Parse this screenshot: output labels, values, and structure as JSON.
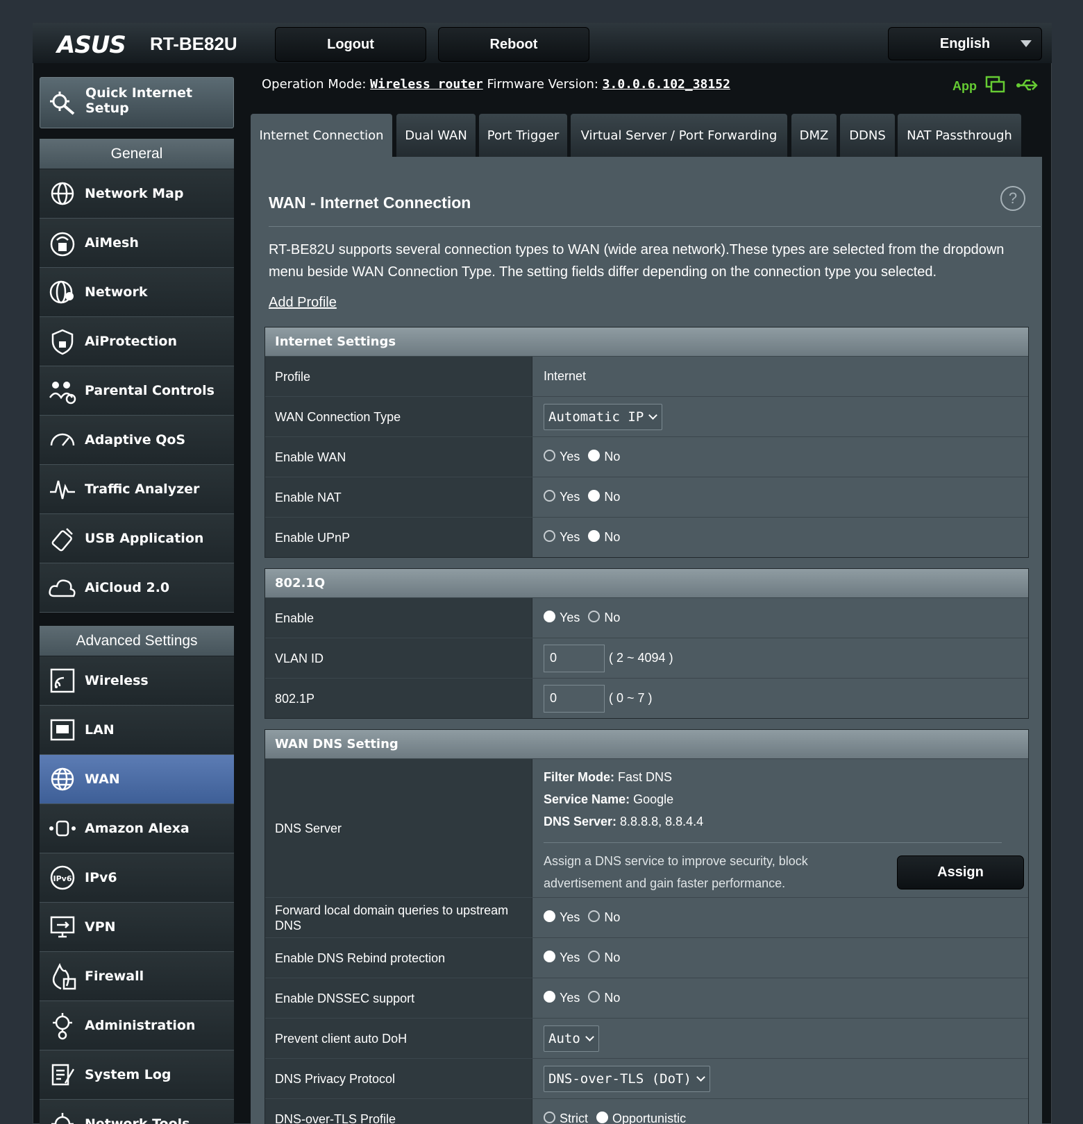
{
  "brand": {
    "logo": "ASUS",
    "model": "RT-BE82U"
  },
  "topbar": {
    "logout": "Logout",
    "reboot": "Reboot",
    "language": "English"
  },
  "status": {
    "op_mode_label": "Operation Mode:",
    "op_mode_value": "Wireless router",
    "fw_label": "Firmware Version:",
    "fw_value": "3.0.0.6.102_38152",
    "app_label": "App"
  },
  "sidebar": {
    "qis_label": "Quick Internet Setup",
    "general_header": "General",
    "general_items": [
      {
        "label": "Network Map",
        "icon": "globe-network-icon"
      },
      {
        "label": "AiMesh",
        "icon": "mesh-router-icon"
      },
      {
        "label": "Network",
        "icon": "globe-users-icon"
      },
      {
        "label": "AiProtection",
        "icon": "shield-lock-icon"
      },
      {
        "label": "Parental Controls",
        "icon": "family-lock-icon"
      },
      {
        "label": "Adaptive QoS",
        "icon": "speedometer-icon"
      },
      {
        "label": "Traffic Analyzer",
        "icon": "waveform-icon"
      },
      {
        "label": "USB Application",
        "icon": "usb-stick-icon"
      },
      {
        "label": "AiCloud 2.0",
        "icon": "cloud-icon"
      }
    ],
    "advanced_header": "Advanced Settings",
    "advanced_items": [
      {
        "label": "Wireless",
        "icon": "wifi-signal-icon"
      },
      {
        "label": "LAN",
        "icon": "lan-port-icon"
      },
      {
        "label": "WAN",
        "icon": "globe-icon",
        "active": true
      },
      {
        "label": "Amazon Alexa",
        "icon": "alexa-device-icon"
      },
      {
        "label": "IPv6",
        "icon": "ipv6-globe-icon"
      },
      {
        "label": "VPN",
        "icon": "vpn-monitor-icon"
      },
      {
        "label": "Firewall",
        "icon": "firewall-flame-icon"
      },
      {
        "label": "Administration",
        "icon": "gear-user-icon"
      },
      {
        "label": "System Log",
        "icon": "log-pen-icon"
      },
      {
        "label": "Network Tools",
        "icon": "tools-gear-icon"
      }
    ]
  },
  "tabs": [
    {
      "label": "Internet Connection",
      "active": true
    },
    {
      "label": "Dual WAN"
    },
    {
      "label": "Port Trigger"
    },
    {
      "label": "Virtual Server / Port Forwarding"
    },
    {
      "label": "DMZ"
    },
    {
      "label": "DDNS"
    },
    {
      "label": "NAT Passthrough"
    }
  ],
  "content": {
    "title": "WAN - Internet Connection",
    "help": "?",
    "description": "RT-BE82U supports several connection types to WAN (wide area network).These types are selected from the dropdown menu beside WAN Connection Type. The setting fields differ depending on the connection type you selected.",
    "add_profile": "Add Profile",
    "yes": "Yes",
    "no": "No",
    "internet_settings": {
      "header": "Internet Settings",
      "profile_label": "Profile",
      "profile_value": "Internet",
      "wan_type_label": "WAN Connection Type",
      "wan_type_value": "Automatic IP",
      "enable_wan_label": "Enable WAN",
      "enable_nat_label": "Enable NAT",
      "enable_upnp_label": "Enable UPnP"
    },
    "dot1q": {
      "header": "802.1Q",
      "enable_label": "Enable",
      "vlan_label": "VLAN ID",
      "vlan_value": "0",
      "vlan_hint": "( 2 ~ 4094 )",
      "p_label": "802.1P",
      "p_value": "0",
      "p_hint": "( 0 ~ 7 )"
    },
    "dns": {
      "header": "WAN DNS Setting",
      "server_label": "DNS Server",
      "filter_mode_key": "Filter Mode:",
      "filter_mode_val": " Fast DNS",
      "service_name_key": "Service Name:",
      "service_name_val": " Google",
      "dns_server_key": "DNS Server:",
      "dns_server_val": " 8.8.8.8, 8.8.4.4",
      "assign_text": "Assign a DNS service to improve security, block advertisement and gain faster performance.",
      "assign_button": "Assign",
      "forward_label": "Forward local domain queries to upstream DNS",
      "rebind_label": "Enable DNS Rebind protection",
      "dnssec_label": "Enable DNSSEC support",
      "doh_label": "Prevent client auto DoH",
      "doh_value": "Auto",
      "privacy_label": "DNS Privacy Protocol",
      "privacy_value": "DNS-over-TLS (DoT)",
      "tls_profile_label": "DNS-over-TLS Profile",
      "strict": "Strict",
      "opportunistic": "Opportunistic"
    }
  },
  "colors": {
    "panel": "#4d5a61",
    "label_cell": "#2f393e",
    "active_menu": "#4a6ba6",
    "app_green": "#66cc33"
  }
}
